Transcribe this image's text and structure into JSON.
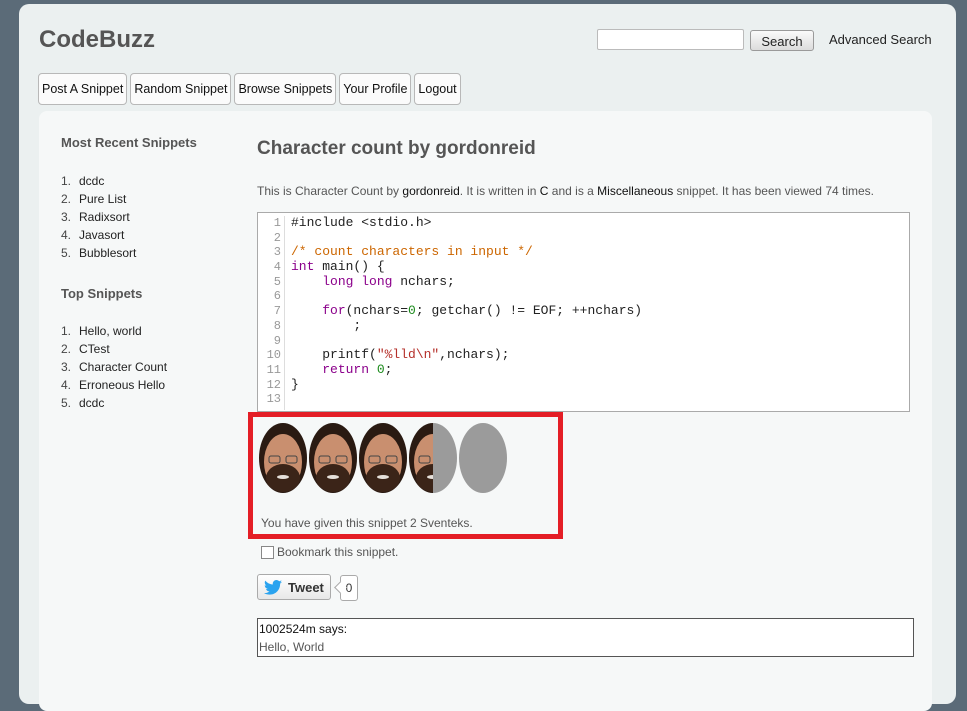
{
  "header": {
    "brand": "CodeBuzz",
    "search_value": "",
    "search_button": "Search",
    "advanced_search": "Advanced Search"
  },
  "nav": [
    "Post A Snippet",
    "Random Snippet",
    "Browse Snippets",
    "Your Profile",
    "Logout"
  ],
  "sidebar": {
    "recent_heading": "Most Recent Snippets",
    "recent": [
      "dcdc",
      "Pure List",
      "Radixsort",
      "Javasort",
      "Bubblesort"
    ],
    "top_heading": "Top Snippets",
    "top": [
      "Hello, world",
      "CTest",
      "Character Count",
      "Erroneous Hello",
      "dcdc"
    ]
  },
  "snippet": {
    "title": "Character count by gordonreid",
    "desc_1": "This is Character Count by ",
    "author": "gordonreid",
    "desc_2": ". It is written in ",
    "language": "C",
    "desc_3": " and is a ",
    "category": "Miscellaneous",
    "desc_4": " snippet. It has been viewed 74 times.",
    "line_numbers": [
      "1",
      "2",
      "3",
      "4",
      "5",
      "6",
      "7",
      "8",
      "9",
      "10",
      "11",
      "12",
      "13"
    ]
  },
  "rating": {
    "max": 5,
    "given": 2,
    "text": "You have given this snippet 2 Sventeks.",
    "filled_icon": "face-icon",
    "empty_icon": "face-outline-icon"
  },
  "bookmark_label": "Bookmark this snippet.",
  "tweet": {
    "label": "Tweet",
    "count": "0"
  },
  "comment": {
    "author": "1002524m says:",
    "body": "Hello, World"
  },
  "colors": {
    "highlight_border": "#e41e26",
    "keyword": "#8b008b",
    "comment": "#cc6600",
    "string": "#b5302a",
    "number": "#1a8a1a"
  }
}
